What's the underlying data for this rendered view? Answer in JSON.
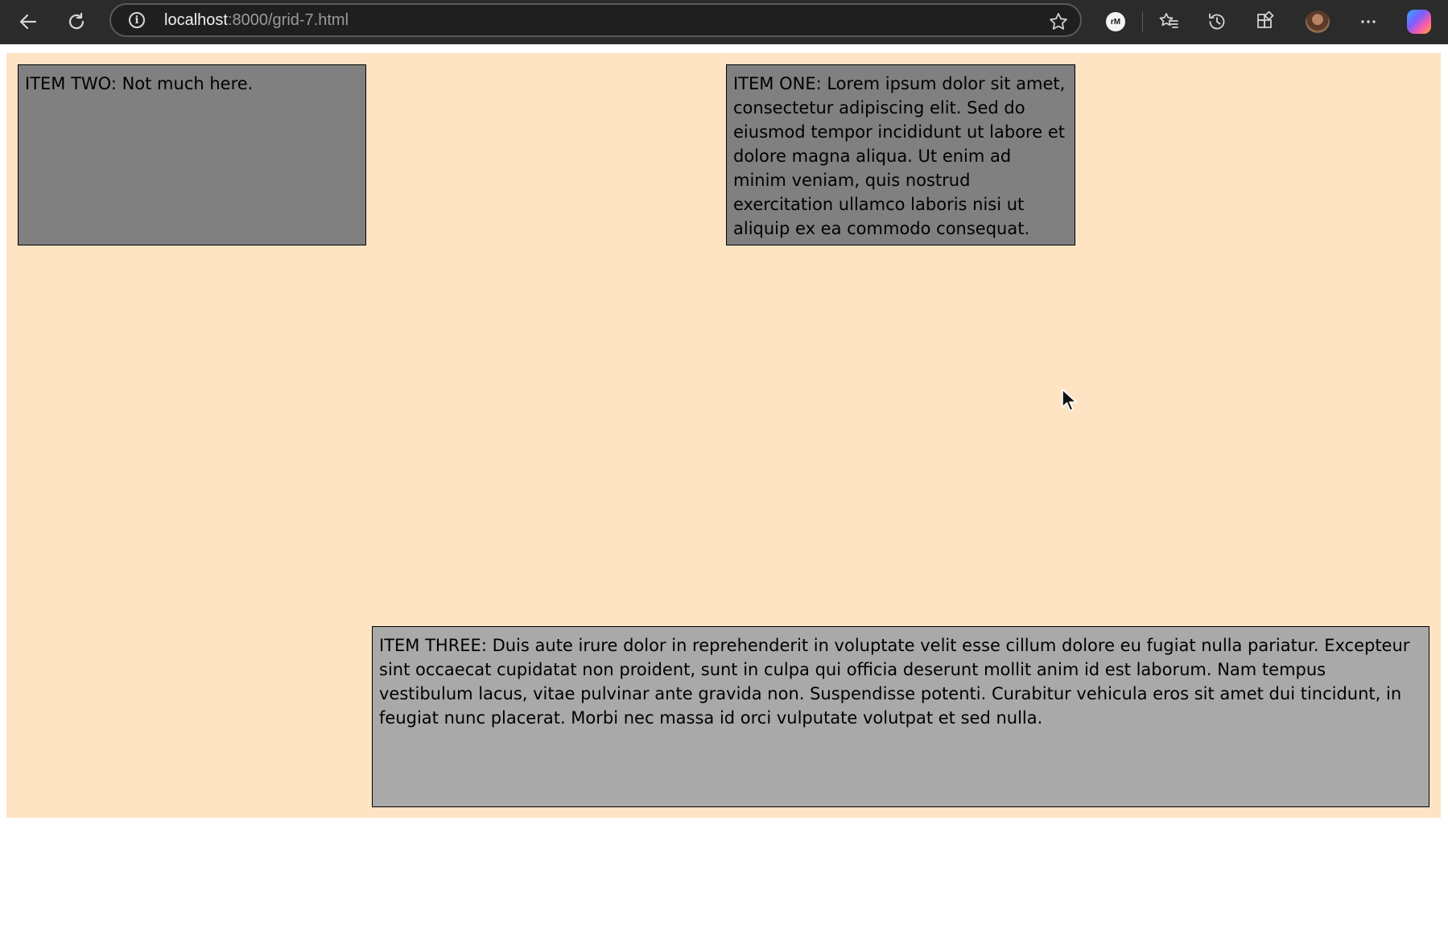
{
  "browser": {
    "url_host": "localhost",
    "url_path": ":8000/grid-7.html",
    "extension_label": "rM"
  },
  "page": {
    "items": {
      "two": {
        "text": "ITEM TWO: Not much here."
      },
      "one": {
        "text": "ITEM ONE: Lorem ipsum dolor sit amet, consectetur adipiscing elit. Sed do eiusmod tempor incididunt ut labore et dolore magna aliqua. Ut enim ad minim veniam, quis nostrud exercitation ullamco laboris nisi ut aliquip ex ea commodo consequat."
      },
      "three": {
        "text": "ITEM THREE: Duis aute irure dolor in reprehenderit in voluptate velit esse cillum dolore eu fugiat nulla pariatur. Excepteur sint occaecat cupidatat non proident, sunt in culpa qui officia deserunt mollit anim id est laborum. Nam tempus vestibulum lacus, vitae pulvinar ante gravida non. Suspendisse potenti. Curabitur vehicula eros sit amet dui tincidunt, in feugiat nunc placerat. Morbi nec massa id orci vulputate volutpat et sed nulla."
      }
    }
  },
  "colors": {
    "container_background": "#ffe4c4",
    "item_background": "#808080",
    "item_three_background": "#a9a9a9",
    "chrome_background": "#2b2b2b"
  },
  "icons": [
    "back-icon",
    "reload-icon",
    "info-icon",
    "star-icon",
    "favorites-icon",
    "history-icon",
    "extensions-icon",
    "more-icon",
    "copilot-icon"
  ]
}
